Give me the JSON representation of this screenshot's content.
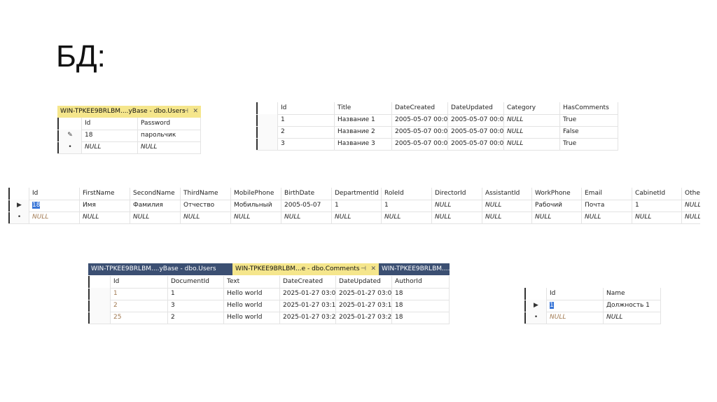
{
  "title": "БД:",
  "grids": [
    {
      "id": "users-small",
      "tabs": [
        {
          "label": "WIN-TPKEE9BRLBM....yBase - dbo.Users",
          "active": true,
          "pin_icon": "pin-icon",
          "close_icon": "close-icon"
        }
      ],
      "columns": [
        "Id",
        "Password"
      ],
      "rows": [
        {
          "marker": "pencil-icon",
          "cells": [
            "18",
            "парольчик"
          ]
        },
        {
          "marker": "new-row-icon",
          "cells": [
            "NULL",
            "NULL"
          ]
        }
      ]
    },
    {
      "id": "documents",
      "tabs": [],
      "columns": [
        "Id",
        "Title",
        "DateCreated",
        "DateUpdated",
        "Category",
        "HasComments"
      ],
      "rows": [
        {
          "marker": "",
          "cells": [
            "1",
            "Название 1",
            "2005-05-07 00:0...",
            "2005-05-07 00:0...",
            "NULL",
            "True"
          ]
        },
        {
          "marker": "",
          "cells": [
            "2",
            "Название 2",
            "2005-05-07 00:0...",
            "2005-05-07 00:0...",
            "NULL",
            "False"
          ]
        },
        {
          "marker": "",
          "cells": [
            "3",
            "Название 3",
            "2005-05-07 00:0...",
            "2005-05-07 00:0...",
            "NULL",
            "True"
          ]
        }
      ]
    },
    {
      "id": "users-wide",
      "tabs": [],
      "columns": [
        "Id",
        "FirstName",
        "SecondName",
        "ThirdName",
        "MobilePhone",
        "BirthDate",
        "DepartmentId",
        "RoleId",
        "DirectorId",
        "AssistantId",
        "WorkPhone",
        "Email",
        "CabinetId",
        "OtherInfo"
      ],
      "rows": [
        {
          "marker": "current-row-icon",
          "cells": [
            "18",
            "Имя",
            "Фамилия",
            "Отчество",
            "Мобильный",
            "2005-05-07",
            "1",
            "1",
            "NULL",
            "NULL",
            "Рабочий",
            "Почта",
            "1",
            "NULL"
          ]
        },
        {
          "marker": "new-row-icon",
          "cells": [
            "NULL",
            "NULL",
            "NULL",
            "NULL",
            "NULL",
            "NULL",
            "NULL",
            "NULL",
            "NULL",
            "NULL",
            "NULL",
            "NULL",
            "NULL",
            "NULL"
          ]
        }
      ]
    },
    {
      "id": "comments",
      "tabs": [
        {
          "label": "WIN-TPKEE9BRLBM....yBase - dbo.Users",
          "active": false
        },
        {
          "label": "WIN-TPKEE9BRLBM...e - dbo.Comments",
          "active": true,
          "pin_icon": "pin-icon",
          "close_icon": "close-icon"
        },
        {
          "label": "WIN-TPKEE9BRLBM....",
          "active": false
        }
      ],
      "columns": [
        "Id",
        "DocumentId",
        "Text",
        "DateCreated",
        "DateUpdated",
        "AuthorId"
      ],
      "rows": [
        {
          "marker": "",
          "cells": [
            "1",
            "1",
            "Hello world",
            "2025-01-27 03:0...",
            "2025-01-27 03:0...",
            "18"
          ]
        },
        {
          "marker": "",
          "cells": [
            "2",
            "3",
            "Hello world",
            "2025-01-27 03:1...",
            "2025-01-27 03:1...",
            "18"
          ]
        },
        {
          "marker": "",
          "cells": [
            "25",
            "2",
            "Hello world",
            "2025-01-27 03:2...",
            "2025-01-27 03:2...",
            "18"
          ]
        }
      ]
    },
    {
      "id": "roles",
      "tabs": [],
      "columns": [
        "Id",
        "Name"
      ],
      "rows": [
        {
          "marker": "current-row-icon",
          "cells": [
            "1",
            "Должность 1"
          ]
        },
        {
          "marker": "new-row-icon",
          "cells": [
            "NULL",
            "NULL"
          ]
        }
      ]
    }
  ]
}
